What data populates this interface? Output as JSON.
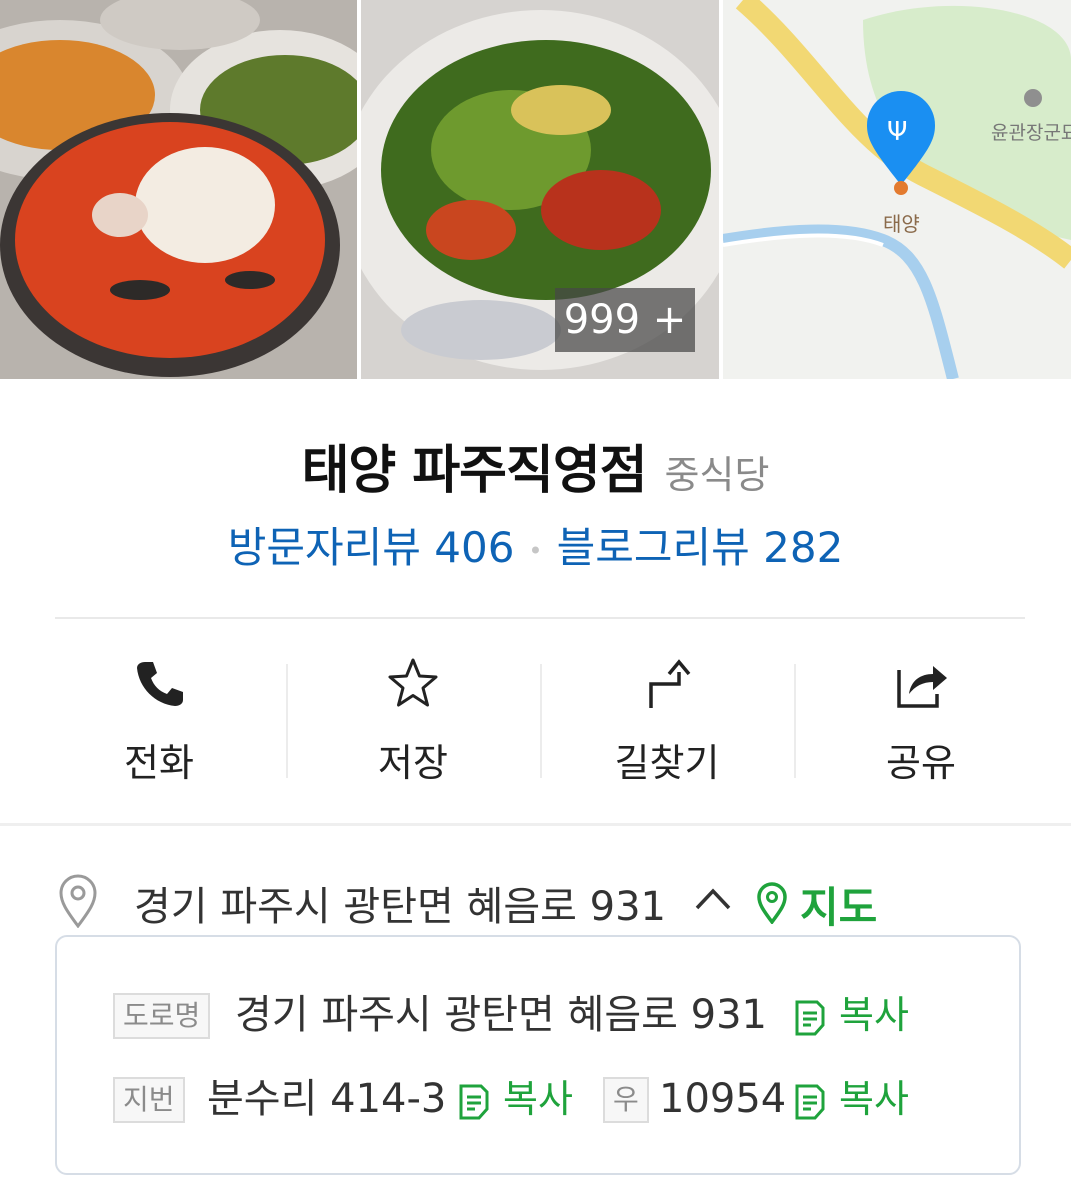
{
  "gallery": {
    "photo_count_badge": "999 +",
    "map_labels": {
      "poi": "태양",
      "landmark": "윤관장군묘"
    }
  },
  "place": {
    "name": "태양 파주직영점",
    "category": "중식당"
  },
  "reviews": {
    "visitor_label": "방문자리뷰 406",
    "blog_label": "블로그리뷰 282"
  },
  "actions": [
    {
      "label": "전화",
      "icon": "phone-icon"
    },
    {
      "label": "저장",
      "icon": "star-icon"
    },
    {
      "label": "길찾기",
      "icon": "directions-icon"
    },
    {
      "label": "공유",
      "icon": "share-icon"
    }
  ],
  "address": {
    "summary": "경기 파주시 광탄면 혜음로 931",
    "map_link": "지도",
    "road_tag": "도로명",
    "road_value": "경기 파주시 광탄면 혜음로 931",
    "lot_tag": "지번",
    "lot_value": "분수리 414-3",
    "zip_tag": "우",
    "zip_value": "10954",
    "copy_label": "복사"
  },
  "colors": {
    "link_blue": "#0e63b5",
    "accent_green": "#1fa33c",
    "map_pin_blue": "#1a8ff2"
  }
}
